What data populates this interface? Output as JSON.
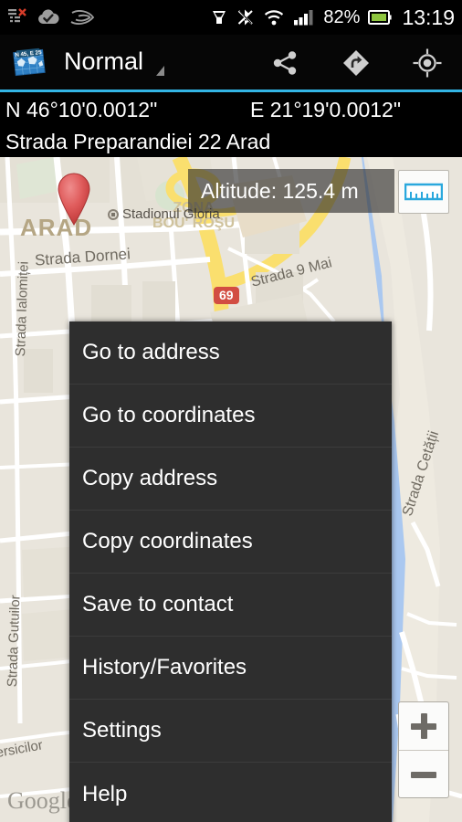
{
  "status_bar": {
    "left_icons": [
      "sync-error-icon",
      "cloud-check-icon",
      "swoosh-icon"
    ],
    "right_icons": [
      "download-cup-icon",
      "bluetooth-off-icon",
      "wifi-icon",
      "signal-bars-icon"
    ],
    "battery_percent": "82%",
    "battery_icon": "battery-icon",
    "clock": "13:19",
    "battery_color": "#8ec63f"
  },
  "action_bar": {
    "app_icon": "map-coordinates-app-icon",
    "app_icon_badge": "N 45, E 25",
    "title": "Normal",
    "spinner_icon": "dropdown-caret-icon",
    "actions": [
      {
        "name": "share-icon",
        "label": "Share"
      },
      {
        "name": "navigate-icon",
        "label": "Navigate"
      },
      {
        "name": "my-location-icon",
        "label": "My location"
      }
    ],
    "accent_color": "#33b5e5"
  },
  "info_bars": {
    "latitude": "N 46°10'0.0012\"",
    "longitude": "E 21°19'0.0012\"",
    "address": "Strada Preparandiei 22 Arad"
  },
  "map": {
    "altitude_label": "Altitude:  125.4 m",
    "ruler_button": "ruler-measure-icon",
    "marker": "location-marker-icon",
    "attribution": "Google",
    "zoom_in_label": "+",
    "zoom_out_label": "−",
    "labels": {
      "city": "ARAD",
      "district_line1": "ZONA",
      "district_line2": "BOU' ROŞU",
      "street_dornei": "Strada Dornei",
      "street_9mai": "Strada 9 Mai",
      "street_ialomitei": "Strada Ialomiței",
      "street_gutuilor_line1": "Strada",
      "street_gutuilor_line2": "Gutuilor",
      "street_cetatii": "Strada Cetății",
      "street_iersicilor": "iersicilor",
      "poi_stadium": "Stadionul Gloria",
      "route_shield": "69"
    }
  },
  "context_menu": {
    "items": [
      {
        "label": "Go to address"
      },
      {
        "label": "Go to coordinates"
      },
      {
        "label": "Copy address"
      },
      {
        "label": "Copy coordinates"
      },
      {
        "label": "Save to contact"
      },
      {
        "label": "History/Favorites"
      },
      {
        "label": "Settings"
      },
      {
        "label": "Help"
      }
    ]
  }
}
